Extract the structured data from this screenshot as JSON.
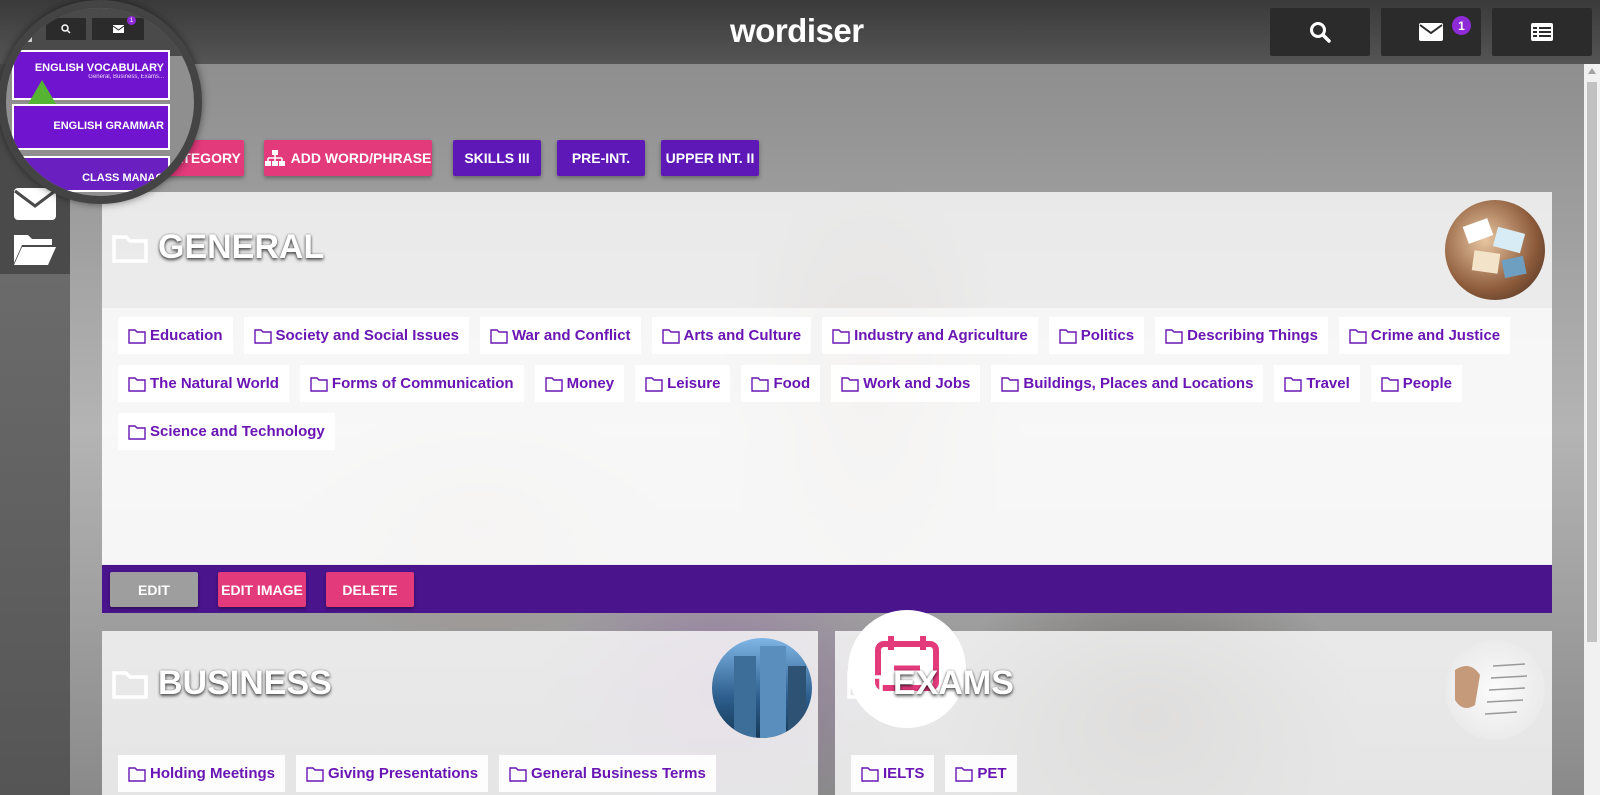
{
  "app": {
    "logo": "wordiser"
  },
  "topbar": {
    "search_icon": "search-icon",
    "mail_icon": "envelope-icon",
    "mail_badge": "1",
    "menu_icon": "list-icon"
  },
  "dropdown": {
    "items": [
      {
        "label": "ENGLISH VOCABULARY",
        "sublabel": "General, Business, Exams..."
      },
      {
        "label": "ENGLISH GRAMMAR"
      },
      {
        "label": "CLASS MANAG"
      }
    ],
    "mini_badge": "1"
  },
  "actions": {
    "category": "CATEGORY",
    "add_word": "ADD WORD/PHRASE",
    "skills": "SKILLS III",
    "pre_int": "PRE-INT.",
    "upper_int": "UPPER INT. II"
  },
  "general": {
    "title": "GENERAL",
    "subcategories": [
      "Education",
      "Society and Social Issues",
      "War and Conflict",
      "Arts and Culture",
      "Industry and Agriculture",
      "Politics",
      "Describing Things",
      "Crime and Justice",
      "The Natural World",
      "Forms of Communication",
      "Money",
      "Leisure",
      "Food",
      "Work and Jobs",
      "Buildings, Places and Locations",
      "Travel",
      "People",
      "Science and Technology"
    ],
    "footer": {
      "edit": "EDIT",
      "edit_image": "EDIT IMAGE",
      "delete": "DELETE"
    }
  },
  "business": {
    "title": "BUSINESS",
    "subcategories": [
      "Holding Meetings",
      "Giving Presentations",
      "General Business Terms"
    ]
  },
  "exams": {
    "title": "EXAMS",
    "subcategories": [
      "IELTS",
      "PET"
    ]
  },
  "colors": {
    "pink": "#e33a7b",
    "purple": "#5e18b8",
    "footer": "#4a148c",
    "link": "#6a16b4"
  }
}
